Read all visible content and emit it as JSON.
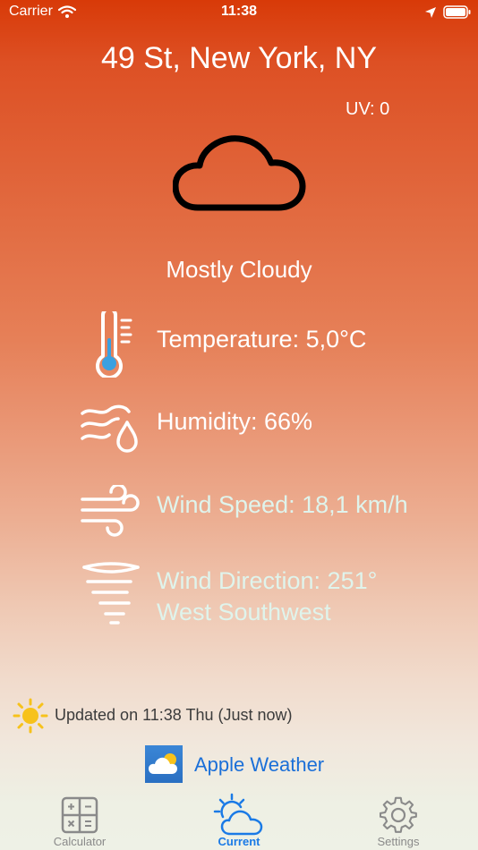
{
  "status_bar": {
    "carrier": "Carrier",
    "time": "11:38"
  },
  "location": "49 St, New York, NY",
  "uv": "UV: 0",
  "condition": "Mostly Cloudy",
  "metrics": {
    "temperature": "Temperature: 5,0°C",
    "humidity": "Humidity: 66%",
    "wind_speed": "Wind Speed: 18,1 km/h",
    "wind_direction_line1": "Wind Direction: 251°",
    "wind_direction_line2": "West Southwest"
  },
  "updated": "Updated on 11:38 Thu (Just now)",
  "source_link": "Apple Weather",
  "tabs": [
    {
      "label": "Calculator",
      "icon": "calculator-icon"
    },
    {
      "label": "Current",
      "icon": "weather-icon"
    },
    {
      "label": "Settings",
      "icon": "gear-icon"
    }
  ],
  "colors": {
    "active_tab": "#1a7ae6",
    "link": "#1a6fd8",
    "thermo_fill": "#3aa0e0"
  }
}
